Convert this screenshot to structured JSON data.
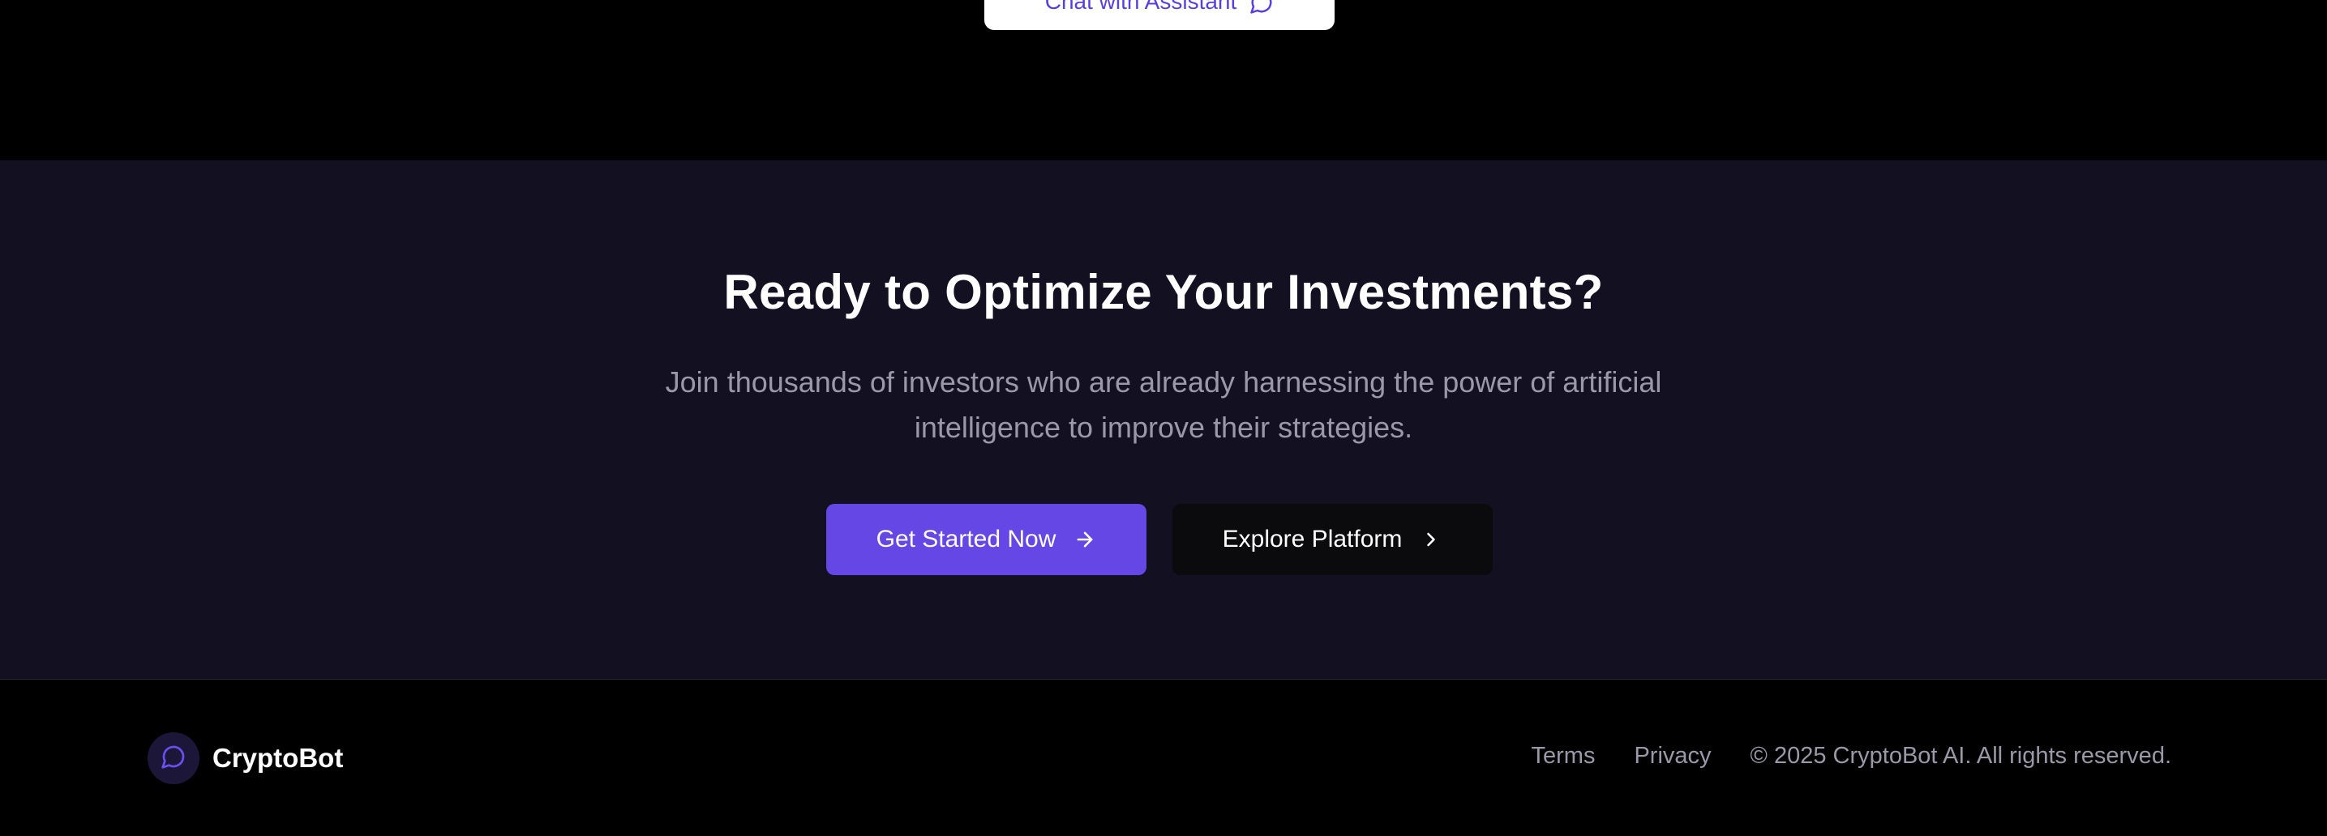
{
  "top": {
    "chat_button_label": "Chat with Assistant"
  },
  "cta": {
    "title": "Ready to Optimize Your Investments?",
    "subtitle": "Join thousands of investors who are already harnessing the power of artificial intelligence to improve their strategies.",
    "primary_button": "Get Started Now",
    "secondary_button": "Explore Platform"
  },
  "footer": {
    "brand": "CryptoBot",
    "links": [
      "Terms",
      "Privacy"
    ],
    "copyright": "© 2025 CryptoBot AI. All rights reserved."
  },
  "icons": {
    "chat_button_icon": "message-circle-icon",
    "primary_button_icon": "arrow-right-icon",
    "secondary_button_icon": "chevron-right-icon",
    "brand_icon": "message-circle-icon"
  },
  "colors": {
    "accent": "#6447e4",
    "cta_background": "#131121",
    "page_background": "#000000",
    "muted_text": "#9b98a8"
  }
}
